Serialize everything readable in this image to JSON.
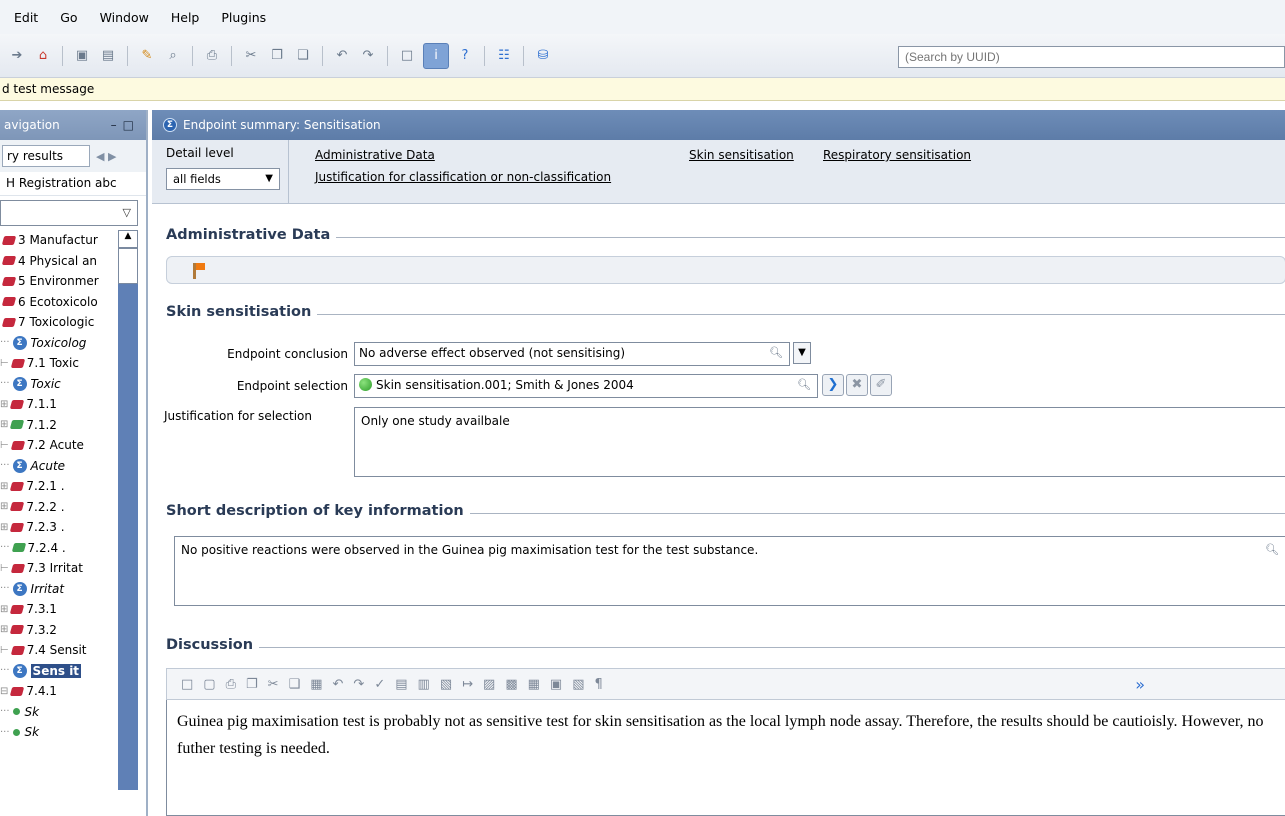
{
  "menu": [
    "Edit",
    "Go",
    "Window",
    "Help",
    "Plugins"
  ],
  "toolbar": {
    "search_placeholder": "(Search by UUID)"
  },
  "message": "d test message",
  "nav": {
    "title": "avigation",
    "tab_label": "ry results",
    "registration": "H Registration abc",
    "tree": [
      {
        "prefix": "",
        "icon": "book-red",
        "label": "3 Manufactur",
        "style": ""
      },
      {
        "prefix": "",
        "icon": "book-red",
        "label": "4 Physical an",
        "style": ""
      },
      {
        "prefix": "",
        "icon": "book-red",
        "label": "5 Environmer",
        "style": ""
      },
      {
        "prefix": "",
        "icon": "book-red",
        "label": "6 Ecotoxicolo",
        "style": ""
      },
      {
        "prefix": "",
        "icon": "book-red",
        "label": "7 Toxicologic",
        "style": ""
      },
      {
        "prefix": "···",
        "icon": "summary",
        "label": "Toxicolog",
        "style": "italic"
      },
      {
        "prefix": "⊢",
        "icon": "book-red",
        "label": "7.1 Toxic",
        "style": ""
      },
      {
        "prefix": "  ···",
        "icon": "summary",
        "label": "Toxic",
        "style": "italic"
      },
      {
        "prefix": "  ⊞",
        "icon": "book-red",
        "label": "7.1.1",
        "style": ""
      },
      {
        "prefix": "  ⊞",
        "icon": "book-green",
        "label": "7.1.2",
        "style": ""
      },
      {
        "prefix": "⊢",
        "icon": "book-red",
        "label": "7.2 Acute",
        "style": ""
      },
      {
        "prefix": "  ···",
        "icon": "summary",
        "label": "Acute",
        "style": "italic"
      },
      {
        "prefix": "  ⊞",
        "icon": "book-red",
        "label": "7.2.1 .",
        "style": ""
      },
      {
        "prefix": "  ⊞",
        "icon": "book-red",
        "label": "7.2.2 .",
        "style": ""
      },
      {
        "prefix": "  ⊞",
        "icon": "book-red",
        "label": "7.2.3 .",
        "style": ""
      },
      {
        "prefix": "  ···",
        "icon": "book-green",
        "label": "7.2.4 .",
        "style": ""
      },
      {
        "prefix": "⊢",
        "icon": "book-red",
        "label": "7.3 Irritat",
        "style": ""
      },
      {
        "prefix": "  ···",
        "icon": "summary",
        "label": "Irritat",
        "style": "italic"
      },
      {
        "prefix": "  ⊞",
        "icon": "book-red",
        "label": "7.3.1",
        "style": ""
      },
      {
        "prefix": "  ⊞",
        "icon": "book-red",
        "label": "7.3.2",
        "style": ""
      },
      {
        "prefix": "⊢",
        "icon": "book-red",
        "label": "7.4 Sensit",
        "style": ""
      },
      {
        "prefix": "  ···",
        "icon": "summary",
        "label": "Sens it",
        "style": "selected"
      },
      {
        "prefix": "  ⊟",
        "icon": "book-red",
        "label": "7.4.1",
        "style": ""
      },
      {
        "prefix": "     ···",
        "icon": "dot",
        "label": "Sk",
        "style": "italic"
      },
      {
        "prefix": "     ···",
        "icon": "dot",
        "label": "Sk",
        "style": "italic"
      }
    ]
  },
  "main": {
    "title": "Endpoint summary: Sensitisation",
    "detail_label": "Detail level",
    "detail_value": "all fields",
    "links": {
      "admin": "Administrative Data",
      "justification": "Justification for classification or non-classification",
      "skin": "Skin sensitisation",
      "resp": "Respiratory sensitisation"
    },
    "admin_title": "Administrative Data",
    "skin": {
      "title": "Skin sensitisation",
      "conclusion_label": "Endpoint conclusion",
      "conclusion_value": "No adverse effect observed (not sensitising)",
      "selection_label": "Endpoint selection",
      "selection_value": "Skin sensitisation.001; Smith & Jones 2004",
      "justification_label": "Justification for selection",
      "justification_value": "Only one study availbale"
    },
    "short": {
      "title": "Short description of key information",
      "value": "No positive reactions were observed in the Guinea pig maximisation test for the test substance."
    },
    "discussion": {
      "title": "Discussion",
      "text": "Guinea pig maximisation test is probably not as sensitive test for skin sensitisation as the local lymph node assay. Therefore, the results should be cautioisly. However, no futher testing is needed."
    }
  }
}
